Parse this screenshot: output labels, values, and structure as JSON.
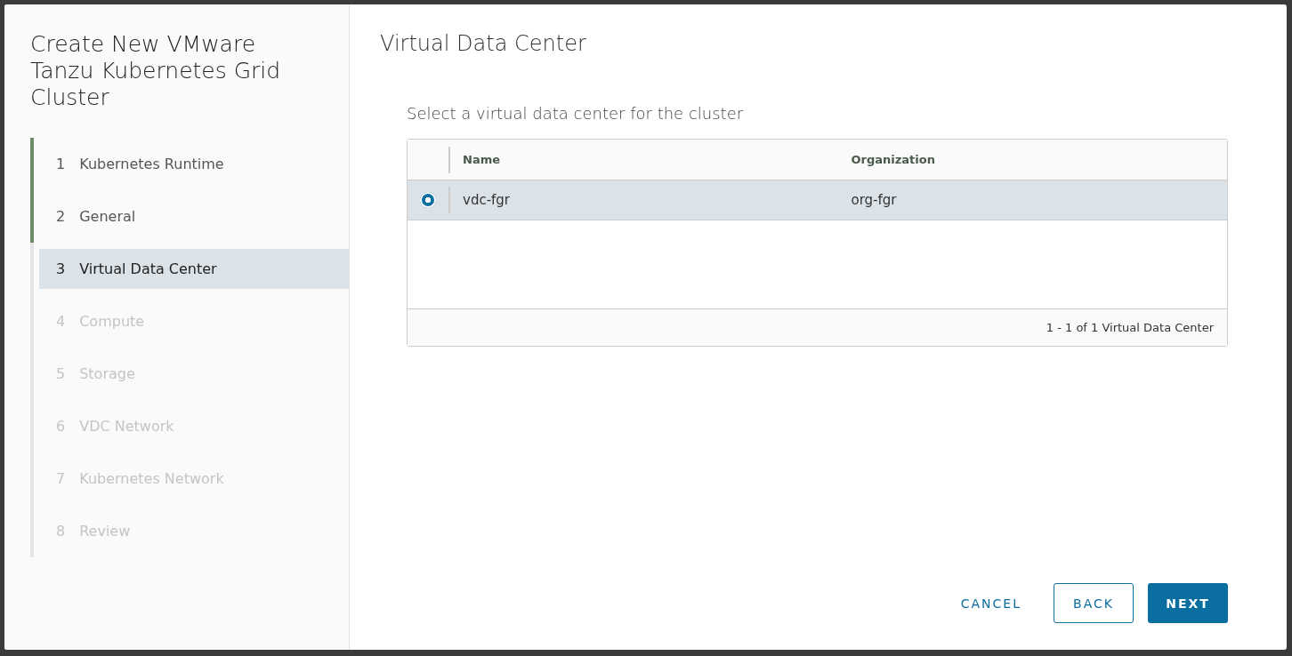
{
  "wizard": {
    "title": "Create New VMware Tanzu Kubernetes Grid Cluster",
    "steps": [
      {
        "number": "1",
        "label": "Kubernetes Runtime",
        "selected": false,
        "completed": true,
        "disabled": false
      },
      {
        "number": "2",
        "label": "General",
        "selected": false,
        "completed": true,
        "disabled": false
      },
      {
        "number": "3",
        "label": "Virtual Data Center",
        "selected": true,
        "completed": false,
        "disabled": false
      },
      {
        "number": "4",
        "label": "Compute",
        "selected": false,
        "completed": false,
        "disabled": true
      },
      {
        "number": "5",
        "label": "Storage",
        "selected": false,
        "completed": false,
        "disabled": true
      },
      {
        "number": "6",
        "label": "VDC Network",
        "selected": false,
        "completed": false,
        "disabled": true
      },
      {
        "number": "7",
        "label": "Kubernetes Network",
        "selected": false,
        "completed": false,
        "disabled": true
      },
      {
        "number": "8",
        "label": "Review",
        "selected": false,
        "completed": false,
        "disabled": true
      }
    ]
  },
  "page": {
    "title": "Virtual Data Center",
    "subtitle": "Select a virtual data center for the cluster"
  },
  "table": {
    "columns": [
      "Name",
      "Organization"
    ],
    "rows": [
      {
        "cells": [
          "vdc-fgr",
          "org-fgr"
        ],
        "selected": true
      }
    ],
    "footer": "1 - 1 of 1 Virtual Data Center"
  },
  "buttons": [
    {
      "label": "CANCEL",
      "kind": "flat"
    },
    {
      "label": "BACK",
      "kind": "outline"
    },
    {
      "label": "NEXT",
      "kind": "primary"
    }
  ]
}
